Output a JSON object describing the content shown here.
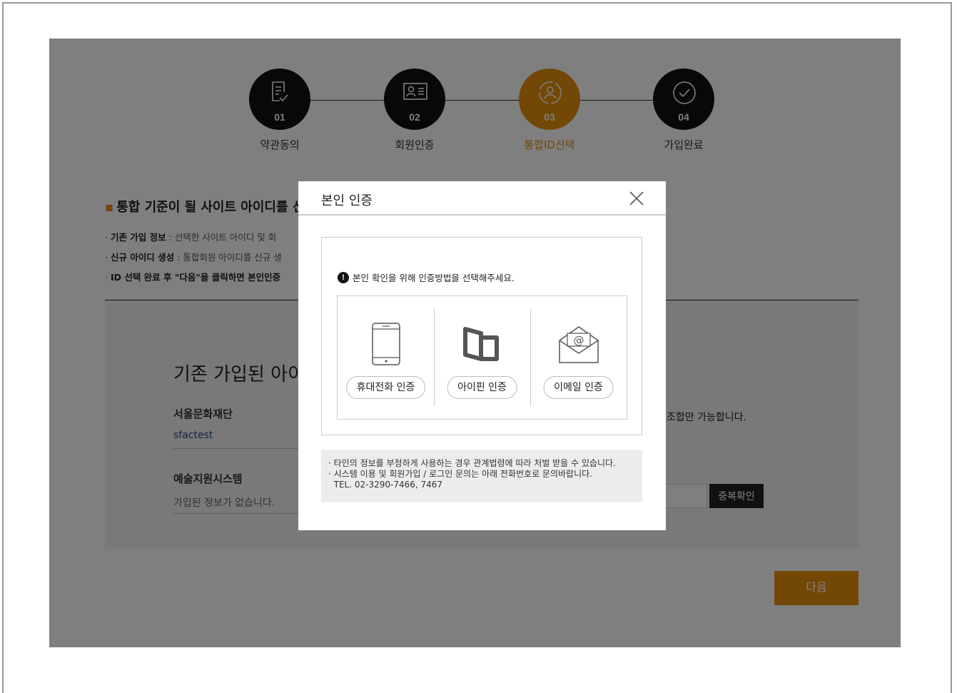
{
  "steps": [
    {
      "num": "01",
      "label": "약관동의",
      "icon": "document-check-icon",
      "active": false
    },
    {
      "num": "02",
      "label": "회원인증",
      "icon": "id-card-icon",
      "active": false
    },
    {
      "num": "03",
      "label": "통합ID선택",
      "icon": "user-sync-icon",
      "active": true
    },
    {
      "num": "04",
      "label": "가입완료",
      "icon": "check-circle-icon",
      "active": false
    }
  ],
  "section": {
    "title": "통합 기준이 될 사이트 아이디를 선",
    "info": [
      {
        "bold": "기존 가입 정보",
        "text": " : 선택한 사이트 아이디 및 회"
      },
      {
        "bold": "신규 아이디 생성",
        "text": " : 통합회원 아이디를 신규 생"
      },
      {
        "bold": "ID 선택 완료 후 \"다음\"을 클릭하면 본인인증",
        "text": ""
      }
    ]
  },
  "existing": {
    "title": "기존 가입된 아이",
    "sites": [
      {
        "name": "서울문화재단",
        "value": "sfactest"
      },
      {
        "name": "예술지원시스템",
        "value": "가입된 정보가 없습니다."
      }
    ],
    "hint": "조합만 가능합니다.",
    "dup_button": "중복확인"
  },
  "next_button": "다음",
  "modal": {
    "title": "본인 인증",
    "notice": "본인 확인을 위해 인증방법을 선택해주세요.",
    "methods": [
      {
        "label": "휴대전화 인증",
        "icon": "mobile-phone-icon"
      },
      {
        "label": "아이핀 인증",
        "icon": "ipin-icon"
      },
      {
        "label": "이메일 인증",
        "icon": "email-envelope-icon"
      }
    ],
    "footer": [
      "· 타인의 정보를 부정하게 사용하는 경우 관계법령에 따라 처벌 받을 수 있습니다.",
      "· 시스템 이용 및 회원가입 / 로그인 문의는 아래 전화번호로 문의바랍니다.",
      "  TEL. 02-3290-7466, 7467"
    ]
  },
  "colors": {
    "accent": "#e6900f",
    "dark": "#111111"
  }
}
